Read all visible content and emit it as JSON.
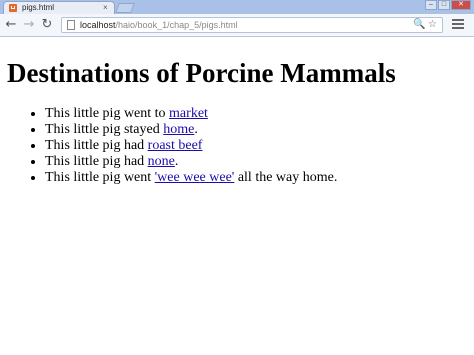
{
  "browser": {
    "tab": {
      "title": "pigs.html",
      "close": "×"
    },
    "window_controls": {
      "minimize": "–",
      "maximize": "□",
      "close": "✕"
    },
    "nav": {
      "back": "←",
      "forward": "→",
      "reload": "↻"
    },
    "address": {
      "host": "localhost",
      "path": "/haio/book_1/chap_5/pigs.html"
    },
    "omnibox_icons": {
      "zoom": "🔍",
      "star": "☆"
    }
  },
  "page": {
    "heading": "Destinations of Porcine Mammals",
    "items": [
      {
        "prefix": "This little pig went to ",
        "link": "market",
        "suffix": ""
      },
      {
        "prefix": "This little pig stayed ",
        "link": "home",
        "suffix": "."
      },
      {
        "prefix": "This little pig had ",
        "link": "roast beef",
        "suffix": ""
      },
      {
        "prefix": "This little pig had ",
        "link": "none",
        "suffix": "."
      },
      {
        "prefix": "This little pig went ",
        "link": "'wee wee wee'",
        "suffix": " all the way home."
      }
    ]
  },
  "colors": {
    "link": "#1a0dab",
    "chrome_frame": "#a9c1e6",
    "favicon": "#e8682a"
  }
}
